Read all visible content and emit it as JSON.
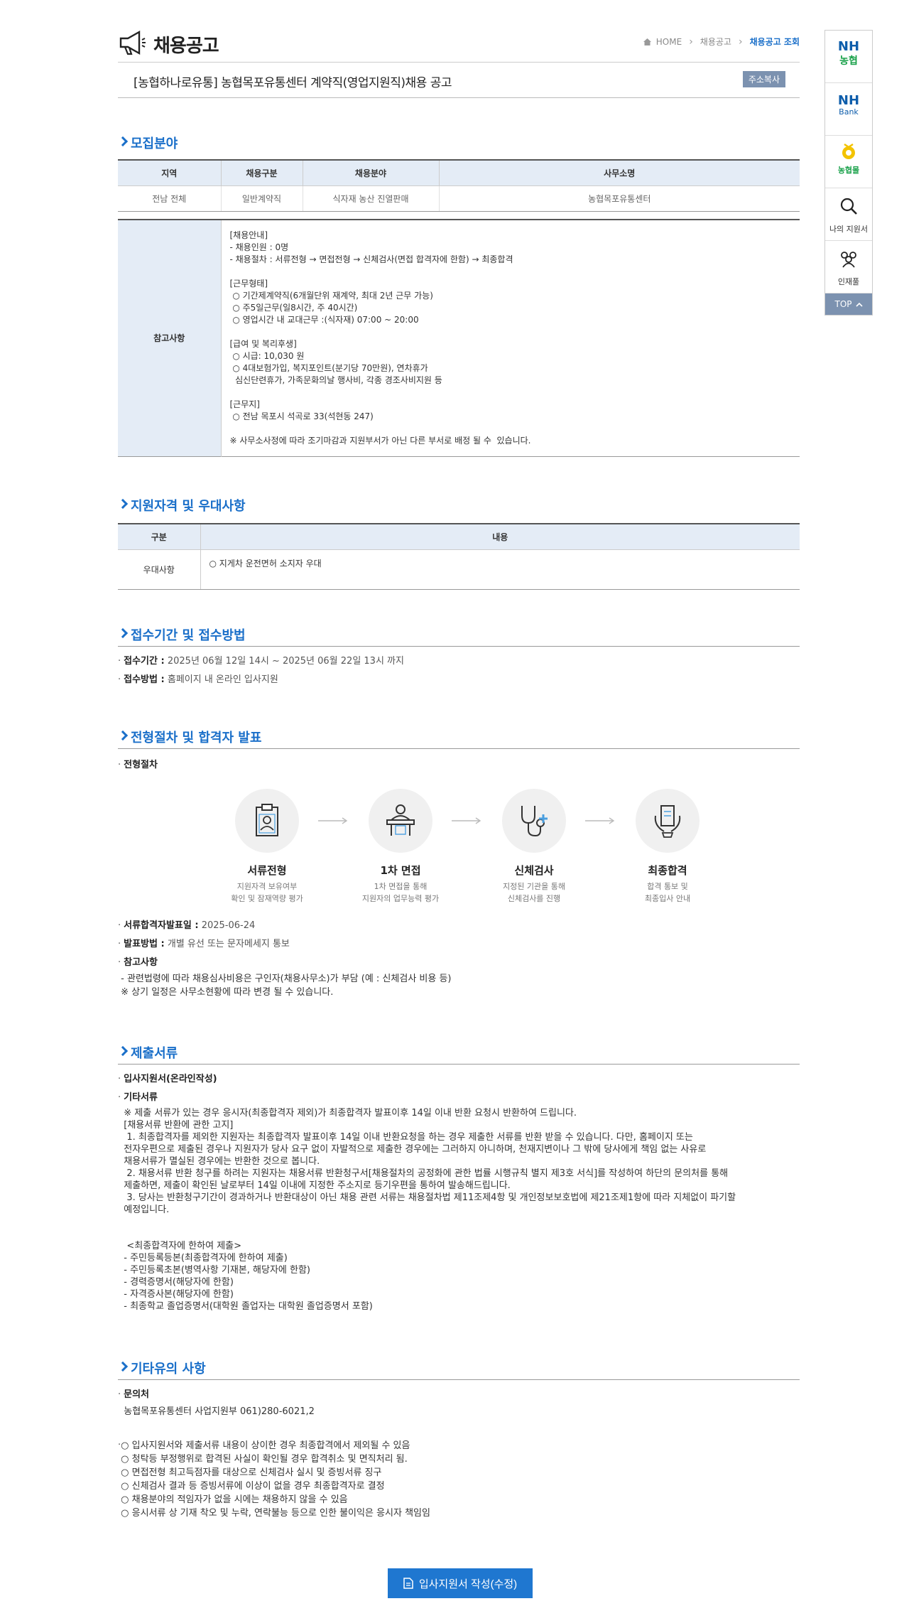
{
  "header": {
    "title": "채용공고",
    "breadcrumb": [
      "HOME",
      "채용공고",
      "채용공고 조회"
    ]
  },
  "post": {
    "title": "[농협하나로유통] 농협목포유통센터 계약직(영업지원직)채용 공고",
    "copy_label": "주소복사"
  },
  "recruit": {
    "heading": "모집분야",
    "columns": [
      "지역",
      "채용구분",
      "채용분야",
      "사무소명"
    ],
    "row": [
      "전남 전체",
      "일반계약직",
      "식자재 농산 진열판매",
      "농협목포유통센터"
    ],
    "note_label": "참고사항",
    "note": "[채용안내]\n- 채용인원 : 0명\n- 채용절차 : 서류전형 → 면접전형 → 신체검사(면접 합격자에 한함) → 최종합격\n\n[근무형태]\n ○ 기간제계약직(6개월단위 재계약, 최대 2년 근무 가능)\n ○ 주5일근무(일8시간, 주 40시간)\n ○ 영업시간 내 교대근무 :(식자재) 07:00 ~ 20:00\n\n[급여 및 복리후생]\n ○ 시급: 10,030 원\n ○ 4대보험가입, 복지포인트(분기당 70만원), 연차휴가\n  심신단련휴가, 가족문화의날 행사비, 각종 경조사비지원 등\n\n[근무지]\n ○ 전남 목포시 석곡로 33(석현동 247)\n\n※ 사무소사정에 따라 조기마감과 지원부서가 아닌 다른 부서로 배정 될 수  있습니다."
  },
  "qualification": {
    "heading": "지원자격 및 우대사항",
    "columns": [
      "구분",
      "내용"
    ],
    "row_label": "우대사항",
    "row_content": "○ 지게차 운전면허 소지자 우대"
  },
  "reception": {
    "heading": "접수기간 및 접수방법",
    "period_label": "접수기간 :",
    "period_value": "2025년 06월 12일 14시 ~ 2025년 06월 22일 13시 까지",
    "method_label": "접수방법 :",
    "method_value": "홈페이지 내 온라인 입사지원"
  },
  "process": {
    "heading": "전형절차 및 합격자 발표",
    "sub_label": "전형절차",
    "steps": [
      {
        "name": "서류전형",
        "desc": "지원자격 보유여부\n확인 및 잠재역량 평가"
      },
      {
        "name": "1차 면접",
        "desc": "1차 면접을 통해\n지원자의 업무능력 평가"
      },
      {
        "name": "신체검사",
        "desc": "지정된 기관을 통해\n신체검사를 진행"
      },
      {
        "name": "최종합격",
        "desc": "합격 통보 및\n최종입사 안내"
      }
    ],
    "doc_result_label": "서류합격자발표일 :",
    "doc_result_value": "2025-06-24",
    "announce_label": "발표방법 :",
    "announce_value": "개별 유선 또는 문자메세지 통보",
    "ref_label": "참고사항",
    "ref_text": " - 관련법령에 따라 채용심사비용은 구인자(채용사무소)가 부담 (예 : 신체검사 비용 등)\n ※ 상기 일정은 사무소현황에 따라 변경 될 수 있습니다."
  },
  "documents": {
    "heading": "제출서류",
    "item1": "입사지원서(온라인작성)",
    "item2": "기타서류",
    "text": "  ※ 제출 서류가 있는 경우 응시자(최종합격자 제외)가 최종합격자 발표이후 14일 이내 반환 요청시 반환하여 드립니다.\n  [채용서류 반환에 관한 고지]\n   1. 최종합격자를 제외한 지원자는 최종합격자 발표이후 14일 이내 반환요청을 하는 경우 제출한 서류를 반환 받을 수 있습니다. 다만, 홈페이지 또는\n  전자우편으로 제출된 경우나 지원자가 당사 요구 없이 자발적으로 제출한 경우에는 그러하지 아니하며, 천재지변이나 그 밖에 당사에게 책임 없는 사유로\n  채용서류가 멸실된 경우에는 반환한 것으로 봅니다.\n   2. 채용서류 반환 청구를 하려는 지원자는 채용서류 반환청구서[채용절차의 공정화에 관한 법률 시행규칙 별지 제3호 서식]를 작성하여 하단의 문의처를 통해\n  제출하면, 제출이 확인된 날로부터 14일 이내에 지정한 주소지로 등기우편을 통하여 발송해드립니다.\n   3. 당사는 반환청구기간이 경과하거나 반환대상이 아닌 채용 관련 서류는 채용절차법 제11조제4항 및 개인정보보호법에 제21조제1항에 따라 지체없이 파기할\n  예정입니다.\n\n\n   <최종합격자에 한하여 제출>\n  - 주민등록등본(최종합격자에 한하여 제출)\n  - 주민등록초본(병역사항 기재본, 해당자에 한함)\n  - 경력증명서(해당자에 한함)\n  - 자격증사본(해당자에 한함)\n  - 최종학교 졸업증명서(대학원 졸업자는 대학원 졸업증명서 포함)"
  },
  "etc": {
    "heading": "기타유의 사항",
    "contact_label": "문의처",
    "contact_value": "  농협목포유통센터 사업지원부 061)280-6021,2",
    "notes": " ○ 입사지원서와 제출서류 내용이 상이한 경우 최종합격에서 제외될 수 있음\n ○ 청탁등 부정행위로 합격된 사실이 확인될 경우 합격취소 및 면직처리 됨.\n ○ 면접전형 최고득점자를 대상으로 신체검사 실시 및 증빙서류 징구\n ○ 신체검사 결과 등 증빙서류에 이상이 없을 경우 최종합격자로 결정\n ○ 채용분야의 적임자가 없을 시에는 채용하지 않을 수 있음\n ○ 응시서류 상 기재 착오 및 누락, 연락불능 등으로 인한 불이익은 응시자 책임임"
  },
  "apply_button": "입사지원서 작성(수정)",
  "quick_menu": {
    "nh1": "NH",
    "nh1_sub": "농협",
    "nh2": "NH",
    "nh2_sub": "Bank",
    "mall": "농협몰",
    "my": "나의 지원서",
    "pool": "인재풀",
    "top": "TOP"
  },
  "colors": {
    "accent": "#1a6fc9",
    "table_head": "#e4ecf6",
    "button": "#1f77d0",
    "nh_blue": "#0d5dab",
    "nh_green": "#19a14a"
  }
}
